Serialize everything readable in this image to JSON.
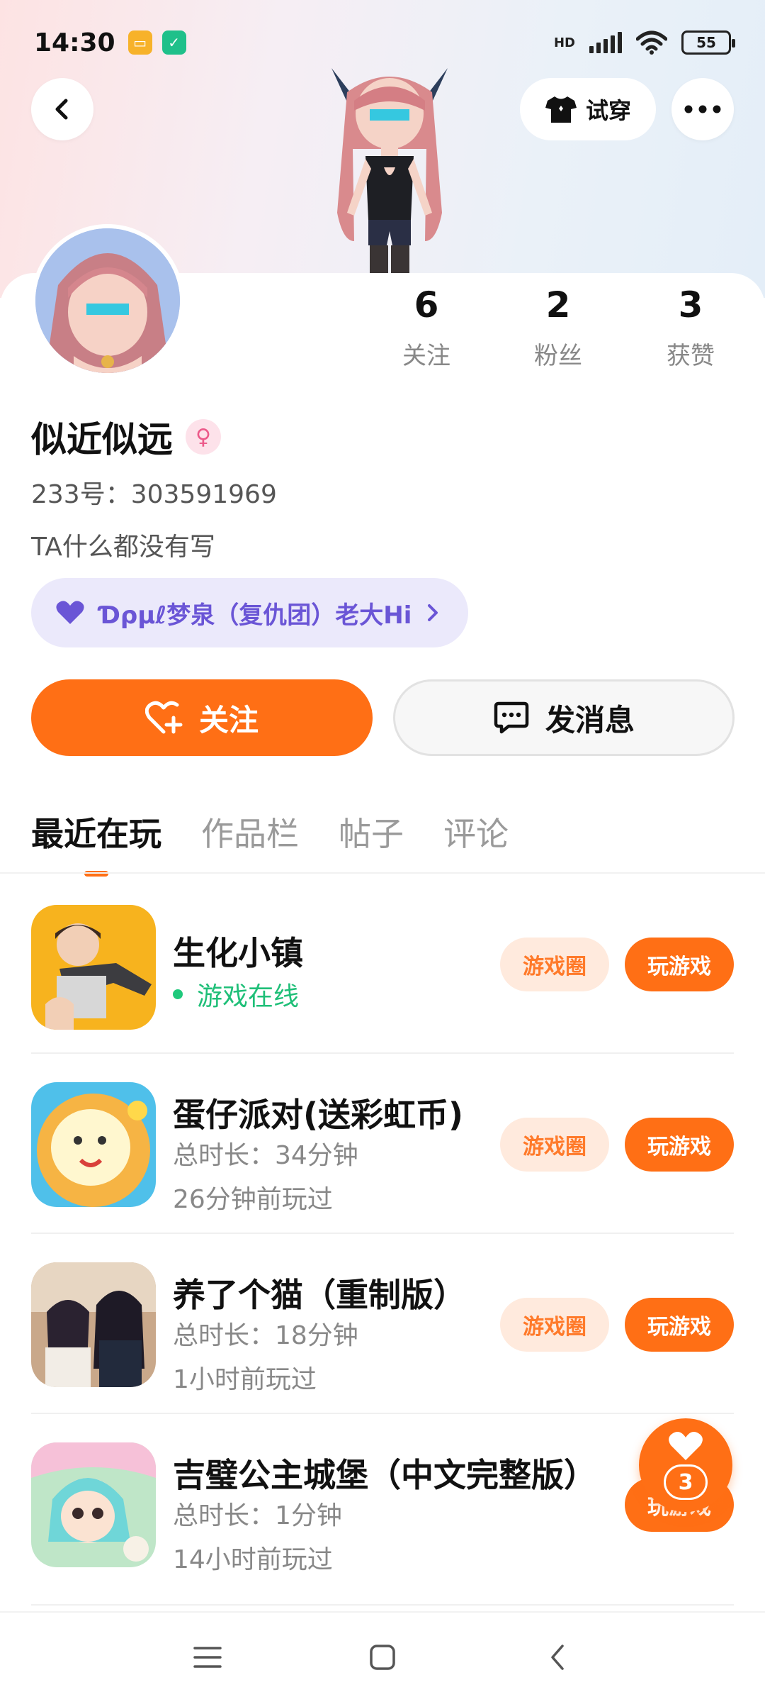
{
  "status_bar": {
    "time": "14:30",
    "network": "HD",
    "battery": "55"
  },
  "header": {
    "try_on_label": "试穿"
  },
  "profile": {
    "name": "似近似远",
    "gender_symbol": "♀",
    "uid": "233号：303591969",
    "bio": "TA什么都没有写",
    "guild": "Ɗρμℓ梦泉（复仇团）老大Hi"
  },
  "stats": [
    {
      "value": "6",
      "label": "关注"
    },
    {
      "value": "2",
      "label": "粉丝"
    },
    {
      "value": "3",
      "label": "获赞"
    }
  ],
  "actions": {
    "follow": "关注",
    "message": "发消息"
  },
  "tabs": [
    "最近在玩",
    "作品栏",
    "帖子",
    "评论"
  ],
  "games": [
    {
      "title": "生化小镇",
      "status": "游戏在线",
      "circle": "游戏圈",
      "play": "玩游戏"
    },
    {
      "title": "蛋仔派对(送彩虹币)",
      "duration": "总时长：34分钟",
      "last_played": "26分钟前玩过",
      "circle": "游戏圈",
      "play": "玩游戏"
    },
    {
      "title": "养了个猫（重制版）",
      "duration": "总时长：18分钟",
      "last_played": "1小时前玩过",
      "circle": "游戏圈",
      "play": "玩游戏"
    },
    {
      "title": "吉璧公主城堡（中文完整版）",
      "duration": "总时长：1分钟",
      "last_played": "14小时前玩过",
      "play": "玩游戏"
    }
  ],
  "floating_like": {
    "count": "3"
  },
  "colors": {
    "accent": "#ff6f15",
    "online": "#1fbf78",
    "guild_text": "#6a55d6"
  }
}
